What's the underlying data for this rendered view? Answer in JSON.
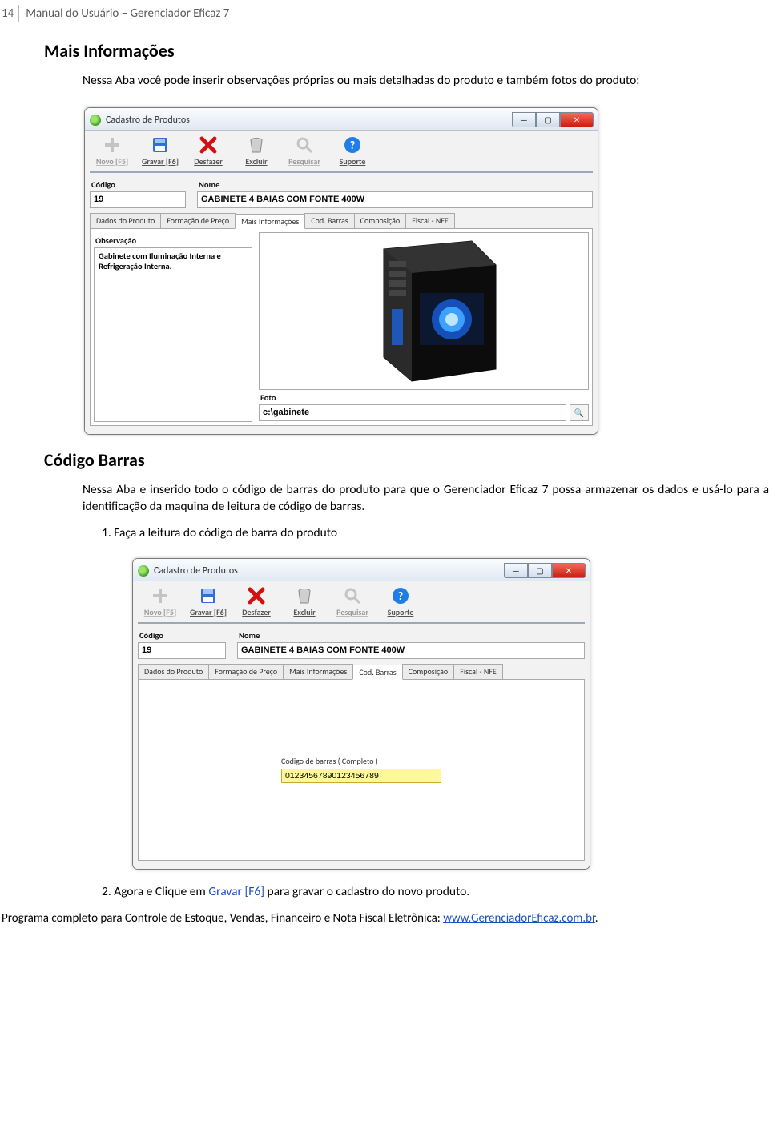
{
  "page": {
    "number": "14",
    "header_title": "Manual do Usuário – Gerenciador Eficaz 7"
  },
  "section1": {
    "title": "Mais Informações",
    "paragraph": "Nessa Aba você pode inserir observações próprias ou mais detalhadas do produto e também fotos do produto:"
  },
  "window": {
    "title": "Cadastro de Produtos",
    "toolbar": {
      "novo": "Novo [F5]",
      "gravar": "Gravar [F6]",
      "desfazer": "Desfazer",
      "excluir": "Excluir",
      "pesquisar": "Pesquisar",
      "suporte": "Suporte"
    },
    "fields": {
      "codigo_label": "Código",
      "codigo_value": "19",
      "nome_label": "Nome",
      "nome_value": "GABINETE 4 BAIAS COM FONTE 400W"
    },
    "tabs": {
      "t1": "Dados do Produto",
      "t2": "Formação de Preço",
      "t3": "Mais Informações",
      "t4": "Cod. Barras",
      "t5": "Composição",
      "t6": "Fiscal - NFE"
    },
    "obs_label": "Observação",
    "obs_text": "Gabinete com Iluminação Interna e Refrigeração Interna.",
    "foto_label": "Foto",
    "foto_value": "c:\\gabinete"
  },
  "section2": {
    "title": "Código Barras",
    "paragraph": "Nessa Aba e inserido todo o código de barras do produto para que o Gerenciador Eficaz 7 possa armazenar os dados e usá-lo para a identificação da maquina de leitura de código de barras.",
    "step1": "1.   Faça a leitura do código de barra do produto",
    "step2_prefix": "2.   Agora e Clique em ",
    "step2_link": "Gravar [F6]",
    "step2_suffix": " para gravar o cadastro do novo produto."
  },
  "barcode": {
    "label": "Codigo de barras ( Completo )",
    "value": "01234567890123456789"
  },
  "footer": {
    "text_prefix": "Programa completo para Controle de Estoque, Vendas, Financeiro e Nota Fiscal Eletrônica: ",
    "link_text": "www.GerenciadorEficaz.com.br",
    "text_suffix": "."
  }
}
